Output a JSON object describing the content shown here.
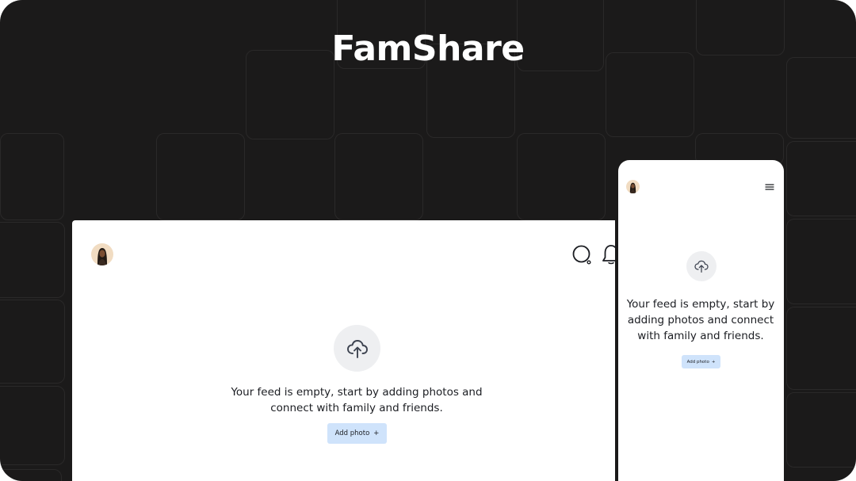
{
  "hero": {
    "title": "FamShare"
  },
  "desktop": {
    "empty_message": "Your feed is empty, start by adding photos and connect with family and friends.",
    "add_photo_label": "Add photo",
    "add_icon": "+",
    "icons": [
      "avatar",
      "search-icon",
      "bell-icon",
      "cloud-upload-icon"
    ]
  },
  "mobile": {
    "empty_message": "Your feed is empty, start by adding photos and connect with family and friends.",
    "add_photo_label": "Add photo",
    "add_icon": "+",
    "icons": [
      "avatar",
      "menu-icon",
      "cloud-upload-icon"
    ]
  },
  "colors": {
    "background": "#1b1a1a",
    "button_bg": "#cfe3fb",
    "upload_circle": "#eeeff1",
    "text": "#1b1d22"
  }
}
